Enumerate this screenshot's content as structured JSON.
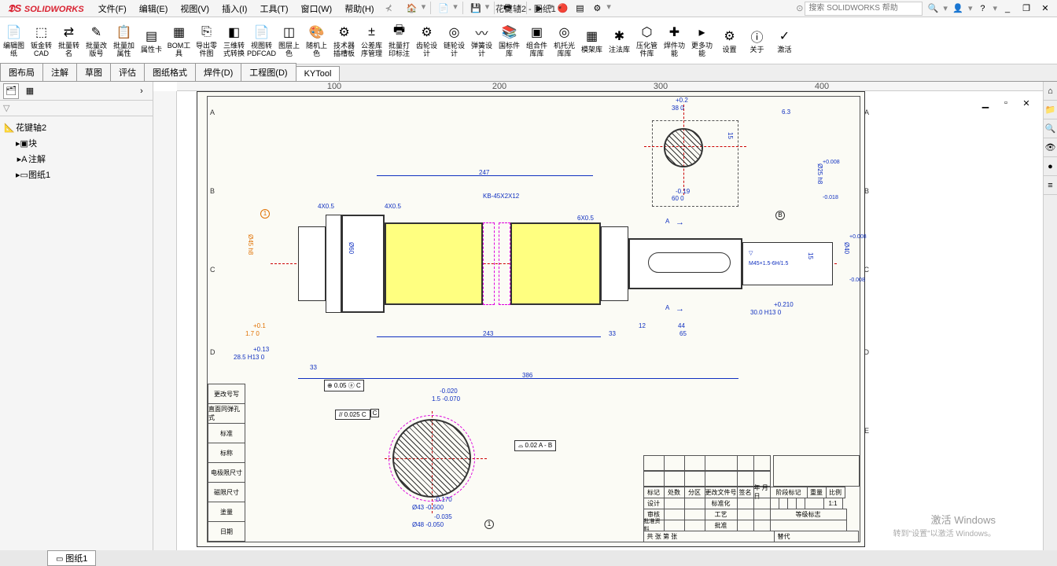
{
  "app": {
    "name": "SOLIDWORKS",
    "doc": "花键轴2 - 图纸1 *"
  },
  "menu": [
    "文件(F)",
    "编辑(E)",
    "视图(V)",
    "插入(I)",
    "工具(T)",
    "窗口(W)",
    "帮助(H)"
  ],
  "search": {
    "placeholder": "搜索 SOLIDWORKS 帮助"
  },
  "ribbon": [
    {
      "l": "编辑图纸",
      "i": "📄"
    },
    {
      "l": "钣金转CAD",
      "i": "⬚"
    },
    {
      "l": "批量转名",
      "i": "⇄"
    },
    {
      "l": "批量改版号",
      "i": "✎"
    },
    {
      "l": "批量加属性",
      "i": "📋"
    },
    {
      "l": "属性卡",
      "i": "▤"
    },
    {
      "l": "BOM工具",
      "i": "▦"
    },
    {
      "l": "导出零件图",
      "i": "⎘"
    },
    {
      "l": "三维转式转换",
      "i": "◧"
    },
    {
      "l": "视图转PDFCAD",
      "i": "📄"
    },
    {
      "l": "图层上色",
      "i": "◫"
    },
    {
      "l": "随机上色",
      "i": "🎨"
    },
    {
      "l": "技术器插槽板",
      "i": "⚙"
    },
    {
      "l": "公差库序管理",
      "i": "±"
    },
    {
      "l": "批量打印标注",
      "i": "🖶"
    },
    {
      "l": "齿轮设计",
      "i": "⚙"
    },
    {
      "l": "链轮设计",
      "i": "◎"
    },
    {
      "l": "弹簧设计",
      "i": "〰"
    },
    {
      "l": "国标件库",
      "i": "📚"
    },
    {
      "l": "组合件库库",
      "i": "▣"
    },
    {
      "l": "机托光库库",
      "i": "◎"
    },
    {
      "l": "模架库",
      "i": "▦"
    },
    {
      "l": "注法库",
      "i": "✱"
    },
    {
      "l": "压化管件库",
      "i": "⬡"
    },
    {
      "l": "焊件功能",
      "i": "✚"
    },
    {
      "l": "更多功能",
      "i": "▸"
    },
    {
      "l": "设置",
      "i": "⚙"
    },
    {
      "l": "关于",
      "i": "ⓘ"
    },
    {
      "l": "激活",
      "i": "✓"
    }
  ],
  "tabs": [
    "图布局",
    "注解",
    "草图",
    "评估",
    "图纸格式",
    "焊件(D)",
    "工程图(D)",
    "KYTool"
  ],
  "activeTab": "KYTool",
  "tree": {
    "root": "花键轴2",
    "children": [
      {
        "i": "▣",
        "l": "块"
      },
      {
        "i": "A",
        "l": "注解"
      },
      {
        "i": "▭",
        "l": "图纸1"
      }
    ]
  },
  "ruler": [
    "100",
    "200",
    "300",
    "400"
  ],
  "zones_left": [
    "A",
    "B",
    "C",
    "D"
  ],
  "zones_right": [
    "A",
    "B",
    "C",
    "D",
    "E"
  ],
  "dims": {
    "d247": "247",
    "d243": "243",
    "d386": "386",
    "d12": "12",
    "d44": "44",
    "d65": "65",
    "d33": "33",
    "t4x05a": "4X0.5",
    "t4x05b": "4X0.5",
    "t6x05": "6X0.5",
    "kb": "KB-45X2X12",
    "tol1": "+0.1",
    "tol1b": "1.7  0",
    "tol13": "+0.13",
    "b285": "28.5 H13  0",
    "tol020": "-0.020",
    "tol070": "1.5 -0.070",
    "tol035": "-0.035",
    "phi48": "Ø48 -0.050",
    "phi43": "Ø43 -0.500",
    "tol170": "-0.170",
    "phi45": "Ø45 h8",
    "phi60": "Ø60",
    "o40": "Ø40",
    "o40t1": "+0.008",
    "o40t2": "-0.008",
    "j25": "Ø25 h8",
    "j25t1": "+0.008",
    "j25t2": "-0.018",
    "gd1": "// 0.025 C",
    "gd2": "⊕ 0.05 ⓐ C",
    "gd3": "⌓ 0.02 A - B",
    "b300": "30.0 H13  0",
    "b300t": "+0.210",
    "sec60": "60  0",
    "sec60t": "+0.2",
    "sec60b": "-0.19",
    "sec38": "38  0",
    "bx": "15",
    "m45": "M45×1.5-6H/1.5",
    "ra63": "6.3",
    "datA": "A",
    "datB": "B",
    "datC": "C",
    "bal1": "1"
  },
  "revtable": [
    "更改号写",
    "直面同弹孔式",
    "标准",
    "标称",
    "电极限尺寸",
    "磁限尺寸",
    "塗量",
    "日期"
  ],
  "titleblock": {
    "hdr": [
      "标记",
      "处数",
      "分区",
      "更改文件号",
      "签名",
      "年 月 日"
    ],
    "r1": [
      "设计",
      "",
      "",
      "标准化",
      "",
      ""
    ],
    "r2": [
      "审核",
      "",
      "",
      "工艺",
      "",
      ""
    ],
    "r3": [
      "批准资料",
      "",
      "",
      "批准",
      "",
      ""
    ],
    "big": [
      "阶段标记",
      "重量",
      "比例"
    ],
    "scale": "1:1",
    "right": "等级标志",
    "foot1": "共  张  第  张",
    "foot2": "替代"
  },
  "watermark": {
    "l1": "激活 Windows",
    "l2": "转到\"设置\"以激活 Windows。"
  },
  "footerSheet": "图纸1"
}
